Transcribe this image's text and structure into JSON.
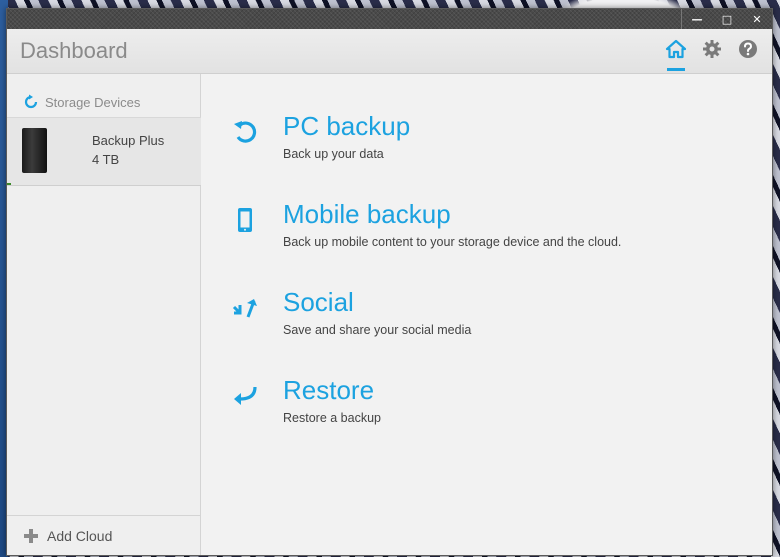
{
  "window": {
    "controls": {
      "minimize": "—",
      "maximize": "□",
      "close": "✕"
    }
  },
  "header": {
    "title": "Dashboard",
    "icons": [
      "home-icon",
      "gear-icon",
      "help-icon"
    ],
    "accent": "#1ca2e0"
  },
  "sidebar": {
    "storage_label": "Storage Devices",
    "device": {
      "name": "Backup Plus",
      "capacity": "4 TB"
    },
    "add_cloud_label": "Add Cloud"
  },
  "actions": [
    {
      "title": "PC backup",
      "subtitle": "Back up your data",
      "icon": "pc-backup-icon"
    },
    {
      "title": "Mobile backup",
      "subtitle": "Back up mobile content to your storage device and the cloud.",
      "icon": "mobile-icon"
    },
    {
      "title": "Social",
      "subtitle": "Save and share your social media",
      "icon": "social-icon"
    },
    {
      "title": "Restore",
      "subtitle": "Restore a backup",
      "icon": "restore-icon"
    }
  ]
}
